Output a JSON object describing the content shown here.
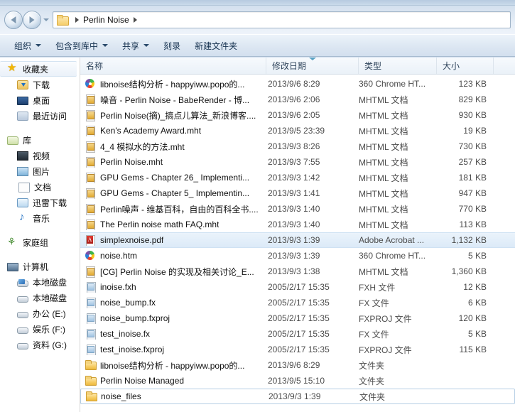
{
  "window": {
    "title": "Perlin Noise"
  },
  "nav": {
    "back_label": "Back",
    "forward_label": "Forward",
    "history_label": "Recent pages",
    "breadcrumb": {
      "folder_icon": "folder-icon",
      "path_label": "Perlin Noise"
    }
  },
  "command_bar": {
    "buttons": [
      {
        "label": "组织",
        "has_caret": true
      },
      {
        "label": "包含到库中",
        "has_caret": true
      },
      {
        "label": "共享",
        "has_caret": true
      },
      {
        "label": "刻录",
        "has_caret": false
      },
      {
        "label": "新建文件夹",
        "has_caret": false
      }
    ]
  },
  "sidebar": {
    "groups": [
      {
        "header": {
          "label": "收藏夹",
          "icon": "star-icon",
          "selected": true
        },
        "items": [
          {
            "label": "下载",
            "icon": "downloads-icon"
          },
          {
            "label": "桌面",
            "icon": "desktop-icon"
          },
          {
            "label": "最近访问",
            "icon": "recent-places-icon"
          }
        ]
      },
      {
        "header": {
          "label": "库",
          "icon": "library-icon",
          "selected": false
        },
        "items": [
          {
            "label": "视频",
            "icon": "videos-icon"
          },
          {
            "label": "图片",
            "icon": "pictures-icon"
          },
          {
            "label": "文档",
            "icon": "documents-icon"
          },
          {
            "label": "迅雷下载",
            "icon": "xunlei-downloads-icon"
          },
          {
            "label": "音乐",
            "icon": "music-icon"
          }
        ]
      },
      {
        "header": {
          "label": "家庭组",
          "icon": "homegroup-icon",
          "selected": false
        },
        "items": []
      },
      {
        "header": {
          "label": "计算机",
          "icon": "computer-icon",
          "selected": false
        },
        "items": [
          {
            "label": "本地磁盘",
            "icon": "system-drive-icon"
          },
          {
            "label": "本地磁盘",
            "icon": "drive-icon"
          },
          {
            "label": "办公 (E:)",
            "icon": "drive-icon"
          },
          {
            "label": "娱乐 (F:)",
            "icon": "drive-icon"
          },
          {
            "label": "资料 (G:)",
            "icon": "drive-icon"
          }
        ]
      }
    ]
  },
  "file_list": {
    "columns": [
      {
        "key": "name",
        "label": "名称",
        "sorted": false
      },
      {
        "key": "date",
        "label": "修改日期",
        "sorted": true
      },
      {
        "key": "type",
        "label": "类型",
        "sorted": false
      },
      {
        "key": "size",
        "label": "大小",
        "sorted": false
      }
    ],
    "rows": [
      {
        "icon": "chrome360-html-icon",
        "name": "libnoise结构分析 - happyiww.popo的...",
        "date": "2013/9/6 8:29",
        "type": "360 Chrome HT...",
        "size": "123 KB",
        "state": "normal"
      },
      {
        "icon": "mhtml-icon",
        "name": "噪音 - Perlin Noise - BabeRender - 博...",
        "date": "2013/9/6 2:06",
        "type": "MHTML 文档",
        "size": "829 KB",
        "state": "normal"
      },
      {
        "icon": "mhtml-icon",
        "name": "Perlin Noise(摘)_搞点儿算法_新浪博客....",
        "date": "2013/9/6 2:05",
        "type": "MHTML 文档",
        "size": "930 KB",
        "state": "normal"
      },
      {
        "icon": "mhtml-icon",
        "name": "Ken's Academy Award.mht",
        "date": "2013/9/5 23:39",
        "type": "MHTML 文档",
        "size": "19 KB",
        "state": "normal"
      },
      {
        "icon": "mhtml-icon",
        "name": "4_4 模拟水的方法.mht",
        "date": "2013/9/3 8:26",
        "type": "MHTML 文档",
        "size": "730 KB",
        "state": "normal"
      },
      {
        "icon": "mhtml-icon",
        "name": "Perlin Noise.mht",
        "date": "2013/9/3 7:55",
        "type": "MHTML 文档",
        "size": "257 KB",
        "state": "normal"
      },
      {
        "icon": "mhtml-icon",
        "name": "GPU Gems - Chapter 26_ Implementi...",
        "date": "2013/9/3 1:42",
        "type": "MHTML 文档",
        "size": "181 KB",
        "state": "normal"
      },
      {
        "icon": "mhtml-icon",
        "name": "GPU Gems - Chapter 5_ Implementin...",
        "date": "2013/9/3 1:41",
        "type": "MHTML 文档",
        "size": "947 KB",
        "state": "normal"
      },
      {
        "icon": "mhtml-icon",
        "name": "Perlin噪声 - 维基百科，自由的百科全书....",
        "date": "2013/9/3 1:40",
        "type": "MHTML 文档",
        "size": "770 KB",
        "state": "normal"
      },
      {
        "icon": "mhtml-icon",
        "name": "The Perlin noise math FAQ.mht",
        "date": "2013/9/3 1:40",
        "type": "MHTML 文档",
        "size": "113 KB",
        "state": "normal"
      },
      {
        "icon": "pdf-icon",
        "name": "simplexnoise.pdf",
        "date": "2013/9/3 1:39",
        "type": "Adobe Acrobat ...",
        "size": "1,132 KB",
        "state": "selected"
      },
      {
        "icon": "chrome360-html-icon",
        "name": "noise.htm",
        "date": "2013/9/3 1:39",
        "type": "360 Chrome HT...",
        "size": "5 KB",
        "state": "normal"
      },
      {
        "icon": "mhtml-icon",
        "name": "[CG] Perlin Noise 的实现及相关讨论_E...",
        "date": "2013/9/3 1:38",
        "type": "MHTML 文档",
        "size": "1,360 KB",
        "state": "normal"
      },
      {
        "icon": "generic-file-icon",
        "name": "inoise.fxh",
        "date": "2005/2/17 15:35",
        "type": "FXH 文件",
        "size": "12 KB",
        "state": "normal"
      },
      {
        "icon": "generic-file-icon",
        "name": "noise_bump.fx",
        "date": "2005/2/17 15:35",
        "type": "FX 文件",
        "size": "6 KB",
        "state": "normal"
      },
      {
        "icon": "generic-file-icon",
        "name": "noise_bump.fxproj",
        "date": "2005/2/17 15:35",
        "type": "FXPROJ 文件",
        "size": "120 KB",
        "state": "normal"
      },
      {
        "icon": "generic-file-icon",
        "name": "test_inoise.fx",
        "date": "2005/2/17 15:35",
        "type": "FX 文件",
        "size": "5 KB",
        "state": "normal"
      },
      {
        "icon": "generic-file-icon",
        "name": "test_inoise.fxproj",
        "date": "2005/2/17 15:35",
        "type": "FXPROJ 文件",
        "size": "115 KB",
        "state": "normal"
      },
      {
        "icon": "folder-icon",
        "name": "libnoise结构分析 - happyiww.popo的...",
        "date": "2013/9/6 8:29",
        "type": "文件夹",
        "size": "",
        "state": "normal"
      },
      {
        "icon": "folder-icon",
        "name": "Perlin Noise Managed",
        "date": "2013/9/5 15:10",
        "type": "文件夹",
        "size": "",
        "state": "normal"
      },
      {
        "icon": "folder-icon",
        "name": "noise_files",
        "date": "2013/9/3 1:39",
        "type": "文件夹",
        "size": "",
        "state": "focused"
      }
    ]
  },
  "colors": {
    "accent": "#2d7fd6",
    "selection": "#dceaf8",
    "chrome": "#d3e0ee"
  }
}
